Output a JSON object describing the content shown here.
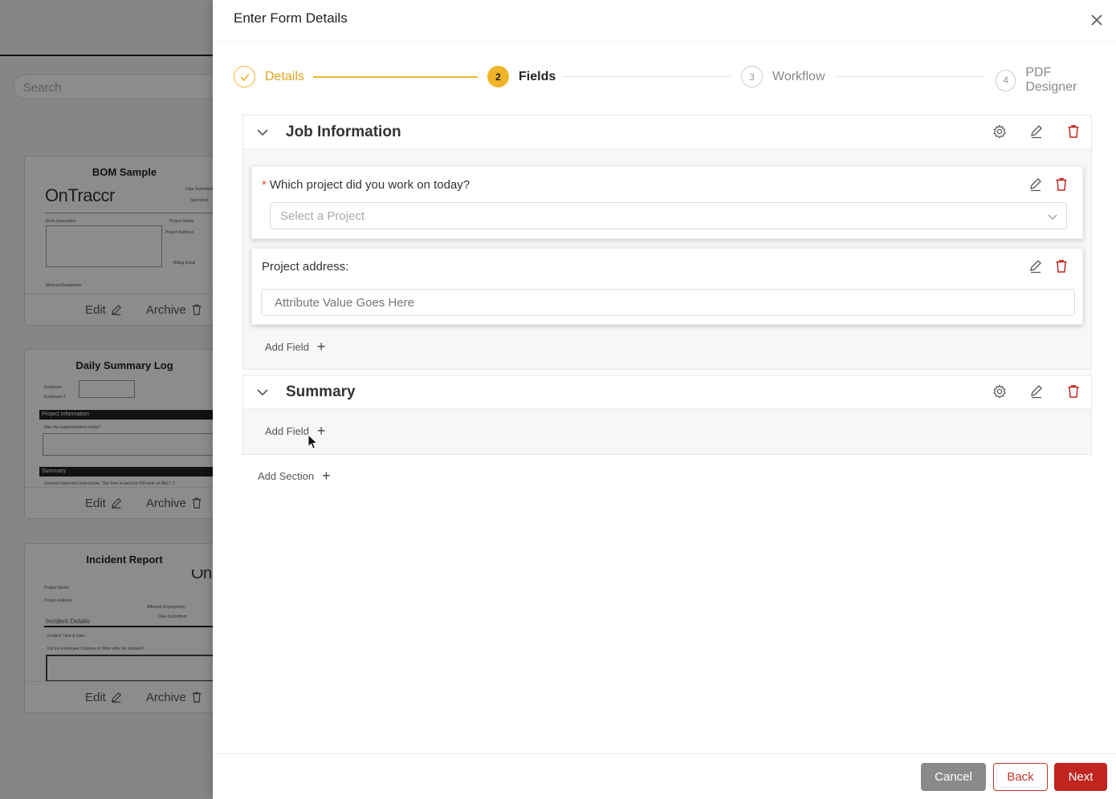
{
  "background": {
    "search_placeholder": "Search",
    "cards": [
      {
        "title": "BOM Sample",
        "edit_label": "Edit",
        "archive_label": "Archive",
        "logo_text": "OnTraccr",
        "preview_text": [
          "Date Submitted",
          "Submitted",
          "Work Description",
          "Project Name",
          "Project Address",
          "Billing Email",
          "Material Breakdown"
        ]
      },
      {
        "title": "Daily Summary Log",
        "edit_label": "Edit",
        "archive_label": "Archive",
        "preview_text": [
          "Employee",
          "Employee #",
          "Project Information",
          "Was the superintendent onsite?",
          "Summary",
          "General Inspection Instructions: This form is used for PM work on BELT C"
        ]
      },
      {
        "title": "Incident Report",
        "edit_label": "Edit",
        "archive_label": "Archive",
        "logo_text": "On",
        "preview_text": [
          "Project Name:",
          "Project Address:",
          "Affected Employee(s):",
          "Date Submitted:",
          "Incident Details",
          "Incident Time & Date:",
          "Did the Employee Continue to Work after the Incident?"
        ]
      }
    ]
  },
  "drawer": {
    "title": "Enter Form Details",
    "steps": [
      {
        "number": "1",
        "label": "Details",
        "state": "done"
      },
      {
        "number": "2",
        "label": "Fields",
        "state": "active"
      },
      {
        "number": "3",
        "label": "Workflow",
        "state": "pending"
      },
      {
        "number": "4",
        "label": "PDF Designer",
        "state": "pending"
      }
    ],
    "sections": [
      {
        "title": "Job Information",
        "fields": [
          {
            "label": "Which project did you work on today?",
            "required": true,
            "type": "select",
            "placeholder": "Select a Project"
          },
          {
            "label": "Project address:",
            "required": false,
            "type": "text",
            "placeholder": "Attribute Value Goes Here"
          }
        ],
        "add_field_label": "Add Field"
      },
      {
        "title": "Summary",
        "fields": [],
        "add_field_label": "Add Field"
      }
    ],
    "add_section_label": "Add Section",
    "buttons": {
      "cancel": "Cancel",
      "back": "Back",
      "next": "Next"
    }
  },
  "colors": {
    "accent": "#f0b429",
    "danger": "#c0261f",
    "overlay": "rgba(0,0,0,0.45)"
  }
}
